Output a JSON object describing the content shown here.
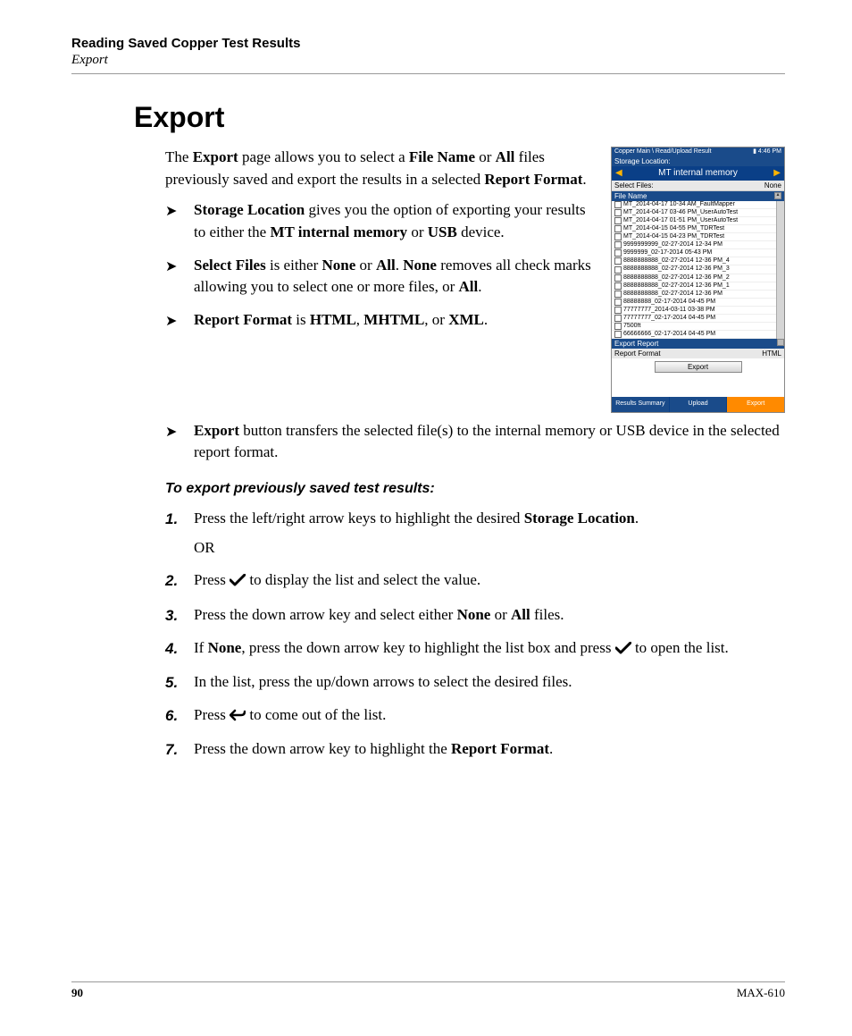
{
  "header": {
    "running_head": "Reading Saved Copper Test Results",
    "running_sub": "Export"
  },
  "section_title": "Export",
  "intro": {
    "p1_a": "The ",
    "p1_b": "Export",
    "p1_c": " page allows you to select a ",
    "p1_d": "File Name",
    "p1_e": " or ",
    "p1_f": "All",
    "p1_g": " files previously saved and export the results in a selected ",
    "p1_h": "Report Format",
    "p1_i": "."
  },
  "bullets": {
    "b1_a": "Storage Location",
    "b1_b": " gives you the option of exporting your results to either the ",
    "b1_c": "MT internal memory",
    "b1_d": " or ",
    "b1_e": "USB",
    "b1_f": " device.",
    "b2_a": "Select Files",
    "b2_b": " is either ",
    "b2_c": "None",
    "b2_d": " or ",
    "b2_e": "All",
    "b2_f": ". ",
    "b2_g": "None",
    "b2_h": " removes all check marks allowing you to select one or more files, or ",
    "b2_i": "All",
    "b2_j": ".",
    "b3_a": "Report Format",
    "b3_b": " is ",
    "b3_c": "HTML",
    "b3_d": ", ",
    "b3_e": "MHTML",
    "b3_f": ", or ",
    "b3_g": "XML",
    "b3_h": ".",
    "b4_a": "Export",
    "b4_b": " button transfers the selected file(s) to the internal memory or USB device in the selected report format."
  },
  "subhead": "To export previously saved test results:",
  "steps": {
    "s1_a": "Press the left/right arrow keys to highlight the desired ",
    "s1_b": "Storage Location",
    "s1_c": ".",
    "s1_or": "OR",
    "s2_a": "Press ",
    "s2_b": " to display the list and select the value.",
    "s3_a": "Press the down arrow key and select either ",
    "s3_b": "None",
    "s3_c": " or ",
    "s3_d": "All",
    "s3_e": " files.",
    "s4_a": "If ",
    "s4_b": "None",
    "s4_c": ", press the down arrow key to highlight the list box and press ",
    "s4_d": " to open the list.",
    "s5": "In the list, press the up/down arrows to select the desired files.",
    "s6_a": "Press ",
    "s6_b": " to come out of the list.",
    "s7_a": "Press the down arrow key to highlight the ",
    "s7_b": "Report Format",
    "s7_c": "."
  },
  "footer": {
    "page": "90",
    "model": "MAX-610"
  },
  "device": {
    "breadcrumb": "Copper Main \\ Read/Upload Result",
    "time": "4:46 PM",
    "storage_label": "Storage Location:",
    "storage_value": "MT internal memory",
    "select_files_label": "Select Files:",
    "select_files_value": "None",
    "filename_col": "File Name",
    "files": [
      "MT_2014-04-17 10-34 AM_FaultMapper",
      "MT_2014-04-17 03-46 PM_UserAutoTest",
      "MT_2014-04-17 01-51 PM_UserAutoTest",
      "MT_2014-04-15 04-55 PM_TDRTest",
      "MT_2014-04-15 04-23 PM_TDRTest",
      "9999999999_02-27-2014 12-34 PM",
      "9999999_02-17-2014 05-43 PM",
      "8888888888_02-27-2014 12-36 PM_4",
      "8888888888_02-27-2014 12-36 PM_3",
      "8888888888_02-27-2014 12-36 PM_2",
      "8888888888_02-27-2014 12-36 PM_1",
      "8888888888_02-27-2014 12-36 PM",
      "88888888_02-17-2014 04-45 PM",
      "77777777_2014-03-11 03-38 PM",
      "77777777_02-17-2014 04-45 PM",
      "7500ft",
      "66666666_02-17-2014 04-45 PM"
    ],
    "export_report_label": "Export Report",
    "report_format_label": "Report Format",
    "report_format_value": "HTML",
    "export_btn": "Export",
    "tabs": {
      "t1": "Results Summary",
      "t2": "Upload",
      "t3": "Export"
    }
  }
}
